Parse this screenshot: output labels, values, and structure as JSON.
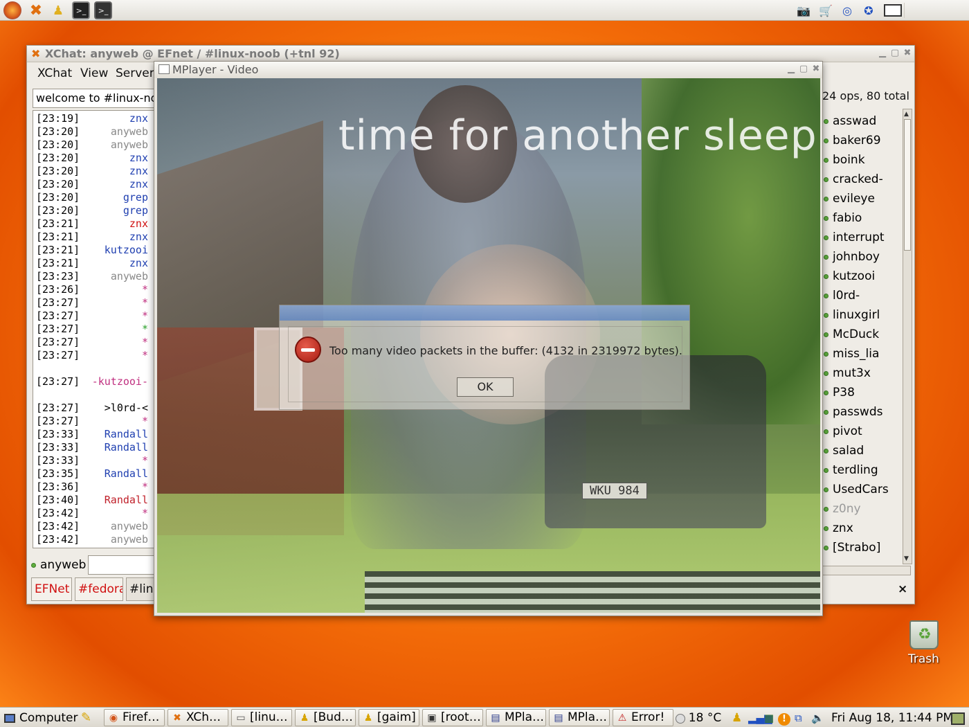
{
  "top_panel": {
    "launchers": [
      "firefox-icon",
      "xchat-icon",
      "gaim-icon",
      "terminal-icon",
      "root-terminal-icon"
    ],
    "tray": [
      "camera-icon",
      "printer-icon",
      "network-icon",
      "globe-icon",
      "window-icon"
    ]
  },
  "xchat": {
    "title": "XChat: anyweb @ EFnet / #linux-noob (+tnl 92)",
    "menu": [
      "XChat",
      "View",
      "Server"
    ],
    "topic": "welcome to #linux-noob",
    "ops_count": "24 ops, 80 total",
    "log": [
      {
        "time": "[23:19]",
        "nick": "znx",
        "color": "#1f3fb0"
      },
      {
        "time": "[23:20]",
        "nick": "anyweb",
        "color": "#888888"
      },
      {
        "time": "[23:20]",
        "nick": "anyweb",
        "color": "#888888"
      },
      {
        "time": "[23:20]",
        "nick": "znx",
        "color": "#1f3fb0"
      },
      {
        "time": "[23:20]",
        "nick": "znx",
        "color": "#1f3fb0"
      },
      {
        "time": "[23:20]",
        "nick": "znx",
        "color": "#1f3fb0"
      },
      {
        "time": "[23:20]",
        "nick": "grep",
        "color": "#1f3fb0"
      },
      {
        "time": "[23:20]",
        "nick": "grep",
        "color": "#1f3fb0"
      },
      {
        "time": "[23:21]",
        "nick": "znx",
        "color": "#d01010"
      },
      {
        "time": "[23:21]",
        "nick": "znx",
        "color": "#1f3fb0"
      },
      {
        "time": "[23:21]",
        "nick": "kutzooi",
        "color": "#1f3fb0"
      },
      {
        "time": "[23:21]",
        "nick": "znx",
        "color": "#1f3fb0"
      },
      {
        "time": "[23:23]",
        "nick": "anyweb",
        "color": "#888888"
      },
      {
        "time": "[23:26]",
        "nick": "*",
        "color": "#c03080"
      },
      {
        "time": "[23:27]",
        "nick": "*",
        "color": "#c03080"
      },
      {
        "time": "[23:27]",
        "nick": "*",
        "color": "#c03080"
      },
      {
        "time": "[23:27]",
        "nick": "*",
        "color": "#2aa02a"
      },
      {
        "time": "[23:27]",
        "nick": "*",
        "color": "#c03080"
      },
      {
        "time": "[23:27]",
        "nick": "*",
        "color": "#c03080"
      },
      {
        "time": "",
        "nick": "",
        "color": "#000000"
      },
      {
        "time": "[23:27]",
        "nick": "-kutzooi-",
        "color": "#c03080"
      },
      {
        "time": "",
        "nick": "",
        "color": "#000000"
      },
      {
        "time": "[23:27]",
        "nick": ">l0rd-<",
        "color": "#000000"
      },
      {
        "time": "[23:27]",
        "nick": "*",
        "color": "#c03080"
      },
      {
        "time": "[23:33]",
        "nick": "Randall",
        "color": "#1f3fb0"
      },
      {
        "time": "[23:33]",
        "nick": "Randall",
        "color": "#1f3fb0"
      },
      {
        "time": "[23:33]",
        "nick": "*",
        "color": "#c03080"
      },
      {
        "time": "[23:35]",
        "nick": "Randall",
        "color": "#1f3fb0"
      },
      {
        "time": "[23:36]",
        "nick": "*",
        "color": "#c03080"
      },
      {
        "time": "[23:40]",
        "nick": "Randall",
        "color": "#c0202a"
      },
      {
        "time": "[23:42]",
        "nick": "*",
        "color": "#c03080"
      },
      {
        "time": "[23:42]",
        "nick": "anyweb",
        "color": "#888888"
      },
      {
        "time": "[23:42]",
        "nick": "anyweb",
        "color": "#888888"
      }
    ],
    "users": [
      "asswad",
      "baker69",
      "boink",
      "cracked-",
      "evileye",
      "fabio",
      "interrupt",
      "johnboy",
      "kutzooi",
      "l0rd-",
      "linuxgirl",
      "McDuck",
      "miss_lia",
      "mut3x",
      "P38",
      "passwds",
      "pivot",
      "salad",
      "terdling",
      "UsedCars",
      "z0ny",
      "znx",
      "[Strabo]"
    ],
    "away_user": "z0ny",
    "nick": "anyweb",
    "tabs": [
      "EFNet",
      "#fedora",
      "#linu"
    ],
    "close_tab": "×"
  },
  "mplayer": {
    "title": "MPlayer - Video",
    "caption": "time for another sleep",
    "plate": "WKU 984"
  },
  "error_dialog": {
    "message": "Too many video packets in the buffer: (4132 in 2319972 bytes).",
    "ok_label": "OK"
  },
  "desktop": {
    "trash_label": "Trash"
  },
  "taskbar": {
    "computer_label": "Computer",
    "tasks": [
      {
        "label": "Firef…",
        "icon": "firefox-icon"
      },
      {
        "label": "XCh…",
        "icon": "xchat-icon"
      },
      {
        "label": "[linu…",
        "icon": "window-icon"
      },
      {
        "label": "[Bud…",
        "icon": "gaim-icon"
      },
      {
        "label": "[gaim]",
        "icon": "gaim-icon"
      },
      {
        "label": "[root…",
        "icon": "terminal-icon"
      },
      {
        "label": "MPla…",
        "icon": "mplayer-icon"
      },
      {
        "label": "MPla…",
        "icon": "mplayer-icon"
      },
      {
        "label": "Error!",
        "icon": "error-icon"
      }
    ],
    "weather": "18 °C",
    "clock": "Fri Aug 18, 11:44 PM"
  }
}
